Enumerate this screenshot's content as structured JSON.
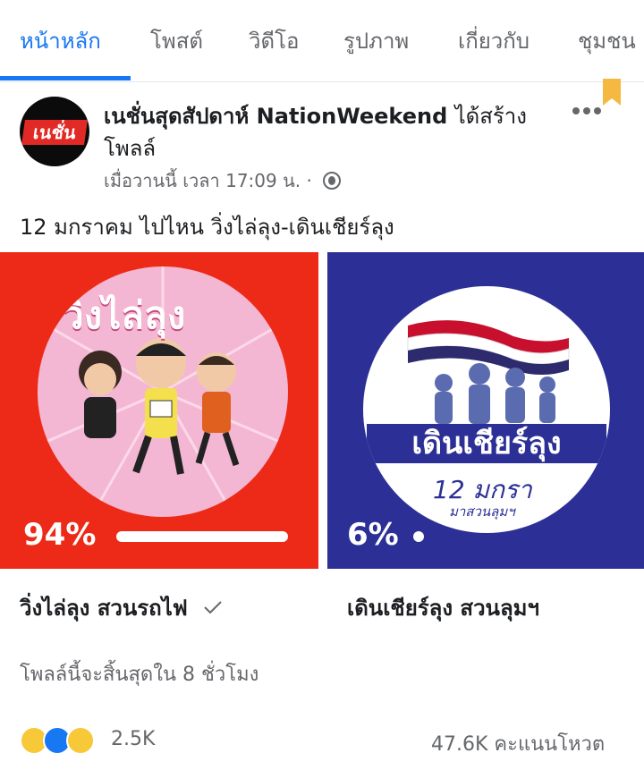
{
  "tabs": [
    {
      "label": "หน้าหลัก",
      "active": true
    },
    {
      "label": "โพสต์",
      "active": false
    },
    {
      "label": "วิดีโอ",
      "active": false
    },
    {
      "label": "รูปภาพ",
      "active": false
    },
    {
      "label": "เกี่ยวกับ",
      "active": false
    },
    {
      "label": "ชุมชน",
      "active": false
    }
  ],
  "post": {
    "avatar_text": "เนชั่น",
    "page_name": "เนชั่นสุดสัปดาห์ NationWeekend",
    "action": "ได้สร้างโพลล์",
    "time": "เมื่อวานนี้ เวลา 17:09 น. ·",
    "text": "12 มกราคม ไปไหน วิ่งไล่ลุง-เดินเชียร์ลุง"
  },
  "poll": {
    "options": [
      {
        "percent_label": "94%",
        "percent": 94,
        "label": "วิ่งไล่ลุง สวนรถไฟ",
        "selected": true,
        "image_text": "วิ่งไล่ลุง",
        "color": "#ed2a17"
      },
      {
        "percent_label": "6%",
        "percent": 6,
        "label": "เดินเชียร์ลุง สวนลุมฯ",
        "selected": false,
        "image_text": "เดินเชียร์ลุง",
        "image_subtext": "12 มกรา",
        "image_subtext2": "มาสวนลุมฯ",
        "color": "#2c3096"
      }
    ],
    "ends_text": "โพลล์นี้จะสิ้นสุดใน 8 ชั่วโมง"
  },
  "footer": {
    "reaction_icons": [
      "haha-icon",
      "like-icon",
      "wow-icon"
    ],
    "reaction_count": "2.5K",
    "vote_count": "47.6K คะแนนโหวต"
  },
  "colors": {
    "accent": "#1877f2",
    "muted": "#65676b"
  }
}
